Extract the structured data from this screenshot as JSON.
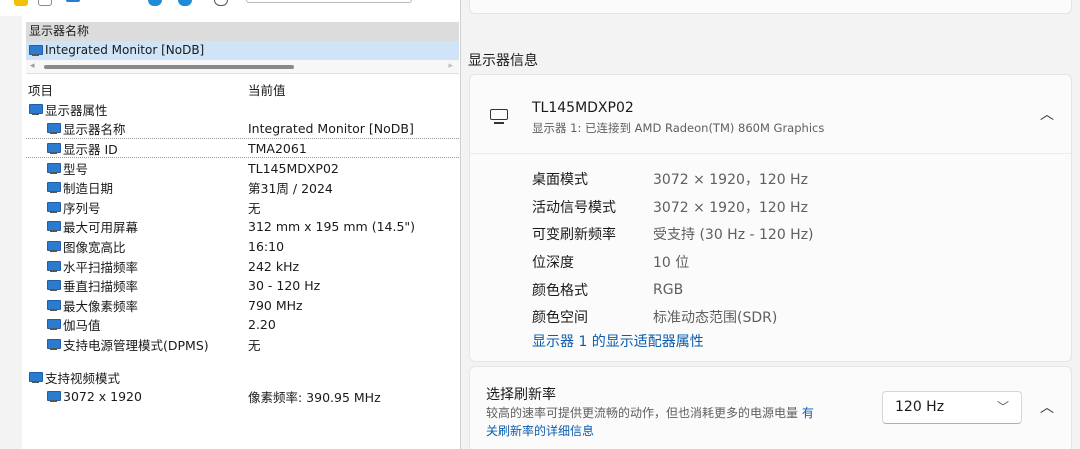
{
  "left_panel": {
    "header_label": "显示器名称",
    "selected_monitor": "Integrated Monitor [NoDB]",
    "columns": [
      "项目",
      "当前值"
    ],
    "group1": {
      "label": "显示器属性",
      "rows": [
        {
          "label": "显示器名称",
          "value": "Integrated Monitor [NoDB]"
        },
        {
          "label": "显示器 ID",
          "value": "TMA2061"
        },
        {
          "label": "型号",
          "value": "TL145MDXP02"
        },
        {
          "label": "制造日期",
          "value": "第31周 / 2024"
        },
        {
          "label": "序列号",
          "value": "无"
        },
        {
          "label": "最大可用屏幕",
          "value": "312 mm x 195 mm (14.5\")"
        },
        {
          "label": "图像宽高比",
          "value": "16:10"
        },
        {
          "label": "水平扫描频率",
          "value": "242 kHz"
        },
        {
          "label": "垂直扫描频率",
          "value": "30 - 120 Hz"
        },
        {
          "label": "最大像素频率",
          "value": "790 MHz"
        },
        {
          "label": "伽马值",
          "value": "2.20"
        },
        {
          "label": "支持电源管理模式(DPMS)",
          "value": "无"
        }
      ]
    },
    "group2": {
      "label": "支持视频模式",
      "rows": [
        {
          "label": "3072 x 1920",
          "value": "像素频率: 390.95 MHz"
        }
      ]
    }
  },
  "right_panel": {
    "section_title": "显示器信息",
    "display": {
      "name": "TL145MDXP02",
      "subtitle": "显示器 1: 已连接到 AMD Radeon(TM) 860M Graphics",
      "props": [
        {
          "label": "桌面模式",
          "value": "3072 × 1920，120 Hz"
        },
        {
          "label": "活动信号模式",
          "value": "3072 × 1920，120 Hz"
        },
        {
          "label": "可变刷新频率",
          "value": "受支持 (30 Hz - 120 Hz)"
        },
        {
          "label": "位深度",
          "value": "10 位"
        },
        {
          "label": "颜色格式",
          "value": "RGB"
        },
        {
          "label": "颜色空间",
          "value": "标准动态范围(SDR)"
        }
      ],
      "adapter_link": "显示器 1 的显示适配器属性"
    },
    "refresh": {
      "title": "选择刷新率",
      "desc": "较高的速率可提供更流畅的动作，但也消耗更多的电源电量",
      "link_part1": "有",
      "link_part2": "关刷新率的详细信息",
      "selected": "120 Hz"
    }
  },
  "colors": {
    "link": "#0b5cad",
    "selection": "#cfe4f7",
    "monitor_icon": "#2b7bd1"
  }
}
